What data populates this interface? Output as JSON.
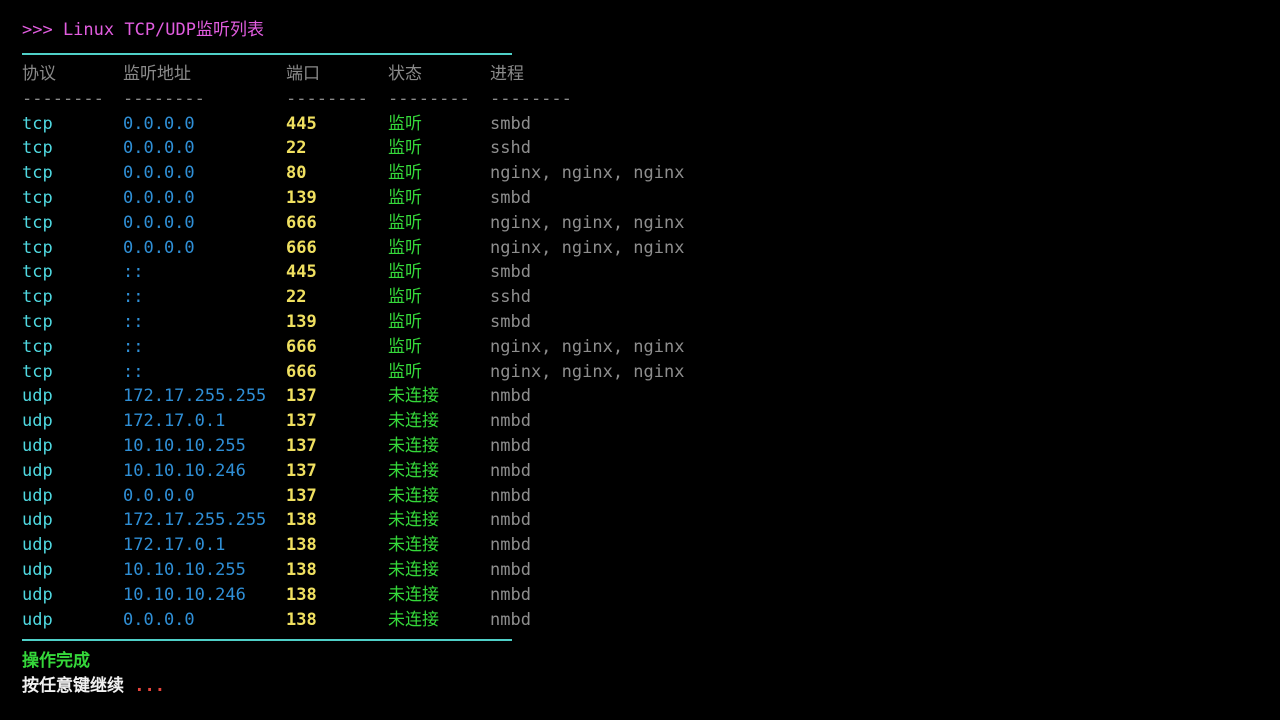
{
  "title": ">>> Linux TCP/UDP监听列表",
  "columns": [
    "协议",
    "监听地址",
    "端口",
    "状态",
    "进程"
  ],
  "separator": "--------",
  "rows": [
    {
      "proto": "tcp",
      "addr": "0.0.0.0",
      "port": "445",
      "state": "监听",
      "proc": "smbd"
    },
    {
      "proto": "tcp",
      "addr": "0.0.0.0",
      "port": "22",
      "state": "监听",
      "proc": "sshd"
    },
    {
      "proto": "tcp",
      "addr": "0.0.0.0",
      "port": "80",
      "state": "监听",
      "proc": "nginx, nginx, nginx"
    },
    {
      "proto": "tcp",
      "addr": "0.0.0.0",
      "port": "139",
      "state": "监听",
      "proc": "smbd"
    },
    {
      "proto": "tcp",
      "addr": "0.0.0.0",
      "port": "666",
      "state": "监听",
      "proc": "nginx, nginx, nginx"
    },
    {
      "proto": "tcp",
      "addr": "0.0.0.0",
      "port": "666",
      "state": "监听",
      "proc": "nginx, nginx, nginx"
    },
    {
      "proto": "tcp",
      "addr": "::",
      "port": "445",
      "state": "监听",
      "proc": "smbd"
    },
    {
      "proto": "tcp",
      "addr": "::",
      "port": "22",
      "state": "监听",
      "proc": "sshd"
    },
    {
      "proto": "tcp",
      "addr": "::",
      "port": "139",
      "state": "监听",
      "proc": "smbd"
    },
    {
      "proto": "tcp",
      "addr": "::",
      "port": "666",
      "state": "监听",
      "proc": "nginx, nginx, nginx"
    },
    {
      "proto": "tcp",
      "addr": "::",
      "port": "666",
      "state": "监听",
      "proc": "nginx, nginx, nginx"
    },
    {
      "proto": "udp",
      "addr": "172.17.255.255",
      "port": "137",
      "state": "未连接",
      "proc": "nmbd"
    },
    {
      "proto": "udp",
      "addr": "172.17.0.1",
      "port": "137",
      "state": "未连接",
      "proc": "nmbd"
    },
    {
      "proto": "udp",
      "addr": "10.10.10.255",
      "port": "137",
      "state": "未连接",
      "proc": "nmbd"
    },
    {
      "proto": "udp",
      "addr": "10.10.10.246",
      "port": "137",
      "state": "未连接",
      "proc": "nmbd"
    },
    {
      "proto": "udp",
      "addr": "0.0.0.0",
      "port": "137",
      "state": "未连接",
      "proc": "nmbd"
    },
    {
      "proto": "udp",
      "addr": "172.17.255.255",
      "port": "138",
      "state": "未连接",
      "proc": "nmbd"
    },
    {
      "proto": "udp",
      "addr": "172.17.0.1",
      "port": "138",
      "state": "未连接",
      "proc": "nmbd"
    },
    {
      "proto": "udp",
      "addr": "10.10.10.255",
      "port": "138",
      "state": "未连接",
      "proc": "nmbd"
    },
    {
      "proto": "udp",
      "addr": "10.10.10.246",
      "port": "138",
      "state": "未连接",
      "proc": "nmbd"
    },
    {
      "proto": "udp",
      "addr": "0.0.0.0",
      "port": "138",
      "state": "未连接",
      "proc": "nmbd"
    }
  ],
  "footer": {
    "done": "操作完成",
    "prompt": "按任意键继续 ",
    "ellipsis": "..."
  },
  "colors": {
    "title": "#e25de0",
    "rule": "#4fd0c8",
    "proto": "#4fd8e0",
    "addr": "#2f8fd6",
    "port": "#f0e060",
    "state": "#35d83a",
    "process": "#8e8e8e",
    "ellipsis": "#e8453c"
  }
}
